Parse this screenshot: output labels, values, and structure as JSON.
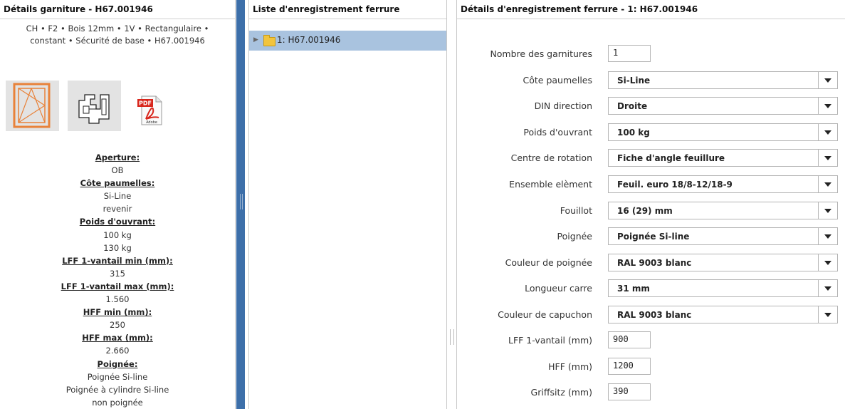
{
  "left_panel": {
    "title": "Détails garniture - H67.001946",
    "summary": "CH  • F2 • Bois 12mm • 1V • Rectangulaire • constant • Sécurité de base • H67.001946",
    "pdf_badge": "PDF",
    "pdf_brand": "Adobe",
    "details": [
      {
        "type": "label",
        "text": "Aperture:"
      },
      {
        "type": "value",
        "text": "OB"
      },
      {
        "type": "label",
        "text": "Côte paumelles:"
      },
      {
        "type": "value",
        "text": "Si-Line"
      },
      {
        "type": "value",
        "text": "revenir"
      },
      {
        "type": "label",
        "text": "Poids d'ouvrant:"
      },
      {
        "type": "value",
        "text": "100 kg"
      },
      {
        "type": "value",
        "text": "130 kg"
      },
      {
        "type": "label",
        "text": "LFF 1-vantail min (mm):"
      },
      {
        "type": "value",
        "text": "315"
      },
      {
        "type": "label",
        "text": "LFF 1-vantail max (mm):"
      },
      {
        "type": "value",
        "text": "1.560"
      },
      {
        "type": "label",
        "text": "HFF min (mm):"
      },
      {
        "type": "value",
        "text": "250"
      },
      {
        "type": "label",
        "text": "HFF max (mm):"
      },
      {
        "type": "value",
        "text": "2.660"
      },
      {
        "type": "label",
        "text": "Poignée:"
      },
      {
        "type": "value",
        "text": "Poignée Si-line"
      },
      {
        "type": "value",
        "text": "Poignée à cylindre Si-line"
      },
      {
        "type": "value",
        "text": "non poignée"
      }
    ]
  },
  "middle_panel": {
    "title": "Liste d'enregistrement ferrure",
    "tree_item": "1: H67.001946"
  },
  "right_panel": {
    "title": "Détails d'enregistrement ferrure - 1: H67.001946",
    "fields": [
      {
        "label": "Nombre des garnitures",
        "kind": "input",
        "value": "1"
      },
      {
        "label": "Côte paumelles",
        "kind": "select",
        "value": "Si-Line"
      },
      {
        "label": "DIN direction",
        "kind": "select",
        "value": "Droite"
      },
      {
        "label": "Poids d'ouvrant",
        "kind": "select",
        "value": "100 kg"
      },
      {
        "label": "Centre de rotation",
        "kind": "select",
        "value": "Fiche d'angle feuillure"
      },
      {
        "label": "Ensemble elèment",
        "kind": "select",
        "value": "Feuil. euro 18/8-12/18-9"
      },
      {
        "label": "Fouillot",
        "kind": "select",
        "value": "16 (29) mm"
      },
      {
        "label": "Poignée",
        "kind": "select",
        "value": "Poignée Si-line"
      },
      {
        "label": "Couleur de poignée",
        "kind": "select",
        "value": "RAL 9003 blanc"
      },
      {
        "label": "Longueur carre",
        "kind": "select",
        "value": "31 mm"
      },
      {
        "label": "Couleur de capuchon",
        "kind": "select",
        "value": "RAL 9003 blanc"
      },
      {
        "label": "LFF 1-vantail (mm)",
        "kind": "input",
        "value": "900"
      },
      {
        "label": "HFF (mm)",
        "kind": "input",
        "value": "1200"
      },
      {
        "label": "Griffsitz (mm)",
        "kind": "input",
        "value": "390"
      }
    ]
  },
  "colors": {
    "divider": "#3d6fa9",
    "selected_row": "#a9c3df",
    "window_frame_icon": "#e8823a",
    "pdf_red": "#d8261c"
  }
}
